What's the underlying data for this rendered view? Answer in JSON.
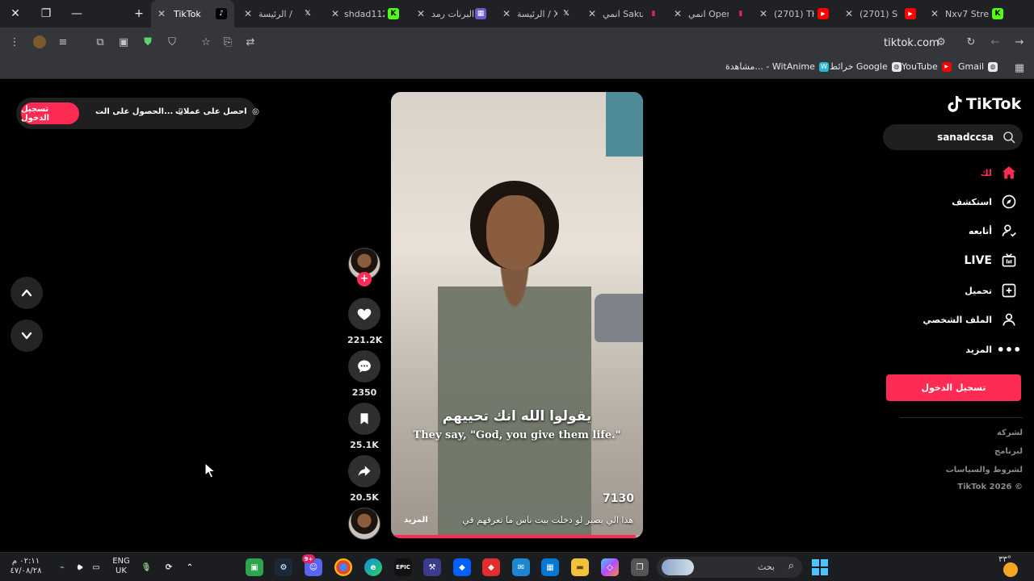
{
  "browser": {
    "tabs": [
      {
        "title": "TikTok",
        "favicon": "tiktok-icon",
        "active": true
      },
      {
        "title": "الرئيسة / X",
        "favicon": "x-icon"
      },
      {
        "title": "shdad112",
        "favicon": "kick-icon"
      },
      {
        "title": "البرنات رمد",
        "favicon": "app-icon"
      },
      {
        "title": "الرئيسة / X",
        "favicon": "x-icon"
      },
      {
        "title": "انمي Sakuta",
        "favicon": "bookmark-icon"
      },
      {
        "title": "انمي Open",
        "favicon": "bookmark-icon"
      },
      {
        "title": "(2701) THE",
        "favicon": "youtube-icon"
      },
      {
        "title": "(2701) Suf",
        "favicon": "youtube-icon"
      },
      {
        "title": "Nxv7 Strea",
        "favicon": "kick-icon"
      }
    ],
    "url": "tiktok.com",
    "bookmarks": [
      {
        "label": "Gmail",
        "icon": "globe-icon"
      },
      {
        "label": "YouTube",
        "icon": "youtube-icon"
      },
      {
        "label": "خرائط Google",
        "icon": "globe-icon"
      },
      {
        "label": "مشاهدة... - WitAnime",
        "icon": "witanime-icon"
      }
    ]
  },
  "tiktok": {
    "logo_text": "TikTok",
    "search_value": "sanadccsa",
    "nav": [
      {
        "label": "لك",
        "icon": "home-icon",
        "active": true
      },
      {
        "label": "استكشف",
        "icon": "compass-icon"
      },
      {
        "label": "أتابعه",
        "icon": "following-icon"
      },
      {
        "label": "LIVE",
        "icon": "live-icon"
      },
      {
        "label": "تحميل",
        "icon": "upload-icon"
      },
      {
        "label": "الملف الشخصي",
        "icon": "profile-icon"
      },
      {
        "label": "المزيد",
        "icon": "more-icon"
      }
    ],
    "sidebar_login": "تسجيل الدخول",
    "footer": [
      "لشركة",
      "لبرنامج",
      "لشروط والسياسات",
      "TikTok 2026 ©"
    ],
    "topbar": {
      "login": "تسجيل الدخول",
      "get_app": "الحصول على الت...",
      "get_coins": "احصل على عملات"
    },
    "video": {
      "subtitle_ar": "يقولوا الله انك تحييهم",
      "subtitle_en": "They say, \"God, you give them life.\"",
      "views": "7130",
      "caption": "هذا الي يصير لو دخلت بيت ناس ما تعرفهم في",
      "more": "المزيد",
      "progress": 0.97
    },
    "actions": {
      "likes": "221.2K",
      "comments": "2350",
      "saves": "25.1K",
      "shares": "20.5K"
    }
  },
  "taskbar": {
    "language": "ENG",
    "region": "UK",
    "time": "٠٢:١١ م",
    "date": "٤٧/٠٨/٢٨",
    "search_placeholder": "بحث",
    "temperature": "٣٣°",
    "notification_badge": "9+"
  }
}
